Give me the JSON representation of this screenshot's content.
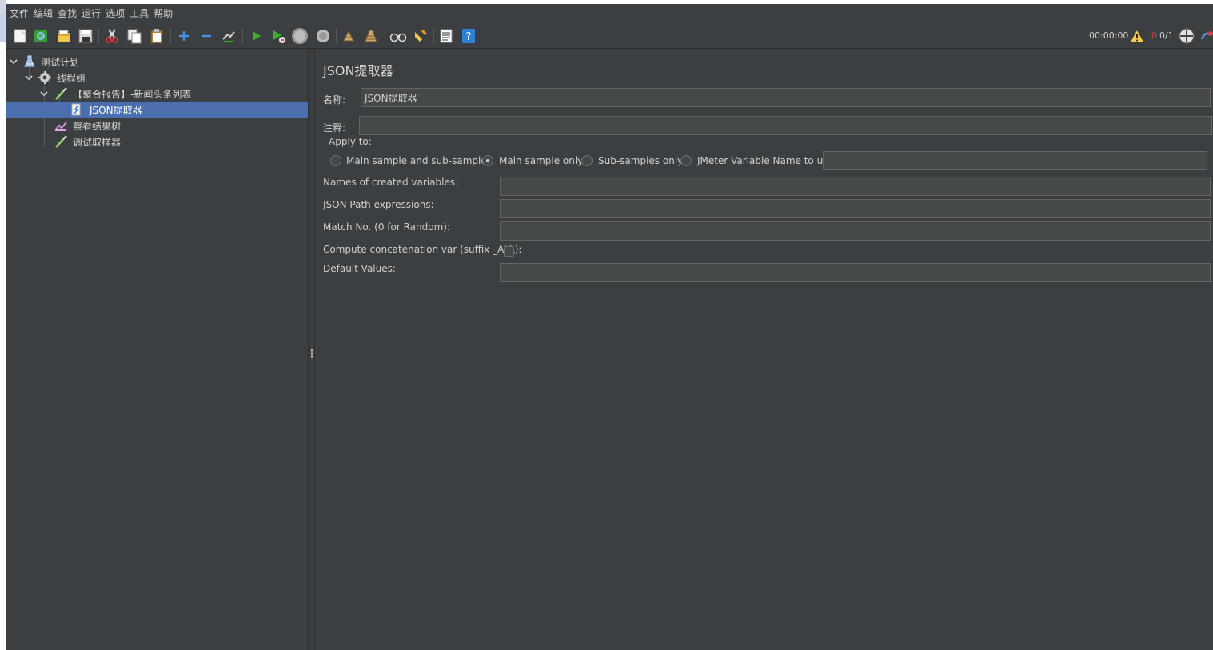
{
  "menu": [
    "文件",
    "编辑",
    "查找",
    "运行",
    "选项",
    "工具",
    "帮助"
  ],
  "toolbar": {
    "timer": "00:00:00",
    "error_count": "0",
    "thread_count": "0/1",
    "icons": [
      "new-icon",
      "templates-icon",
      "open-icon",
      "save-icon",
      "cut-icon",
      "copy-icon",
      "paste-icon",
      "expand-icon",
      "collapse-icon",
      "toggle-icon",
      "start-icon",
      "start-no-pause-icon",
      "stop-icon",
      "shutdown-icon",
      "clear-icon",
      "clear-all-icon",
      "search-icon",
      "reset-search-icon",
      "function-helper-icon",
      "help-icon",
      "warning-icon",
      "remote-icon",
      "lang-icon"
    ]
  },
  "tree": {
    "items": [
      {
        "label": "测试计划",
        "icon": "test-plan-icon"
      },
      {
        "label": "线程组",
        "icon": "thread-group-icon"
      },
      {
        "label": "【聚合报告】-新闻头条列表",
        "icon": "sampler-icon"
      },
      {
        "label": "JSON提取器",
        "icon": "json-extractor-icon"
      },
      {
        "label": "察看结果树",
        "icon": "results-tree-icon"
      },
      {
        "label": "调试取样器",
        "icon": "debug-sampler-icon"
      }
    ]
  },
  "panel": {
    "title": "JSON提取器",
    "name_label": "名称:",
    "name_value": "JSON提取器",
    "comment_label": "注释:",
    "comment_value": "",
    "apply_to_label": "Apply to:",
    "radio_options": [
      "Main sample and sub-samples",
      "Main sample only",
      "Sub-samples only",
      "JMeter Variable Name to use"
    ],
    "selected_radio": "Main sample only",
    "var_name_value": "",
    "created_vars_label": "Names of created variables:",
    "created_vars_value": "",
    "json_path_label": "JSON Path expressions:",
    "json_path_value": "",
    "match_no_label": "Match No. (0 for Random):",
    "match_no_value": "",
    "concat_label": "Compute concatenation var (suffix _ALL):",
    "concat_checked": false,
    "default_values_label": "Default Values:",
    "default_values_value": ""
  },
  "colors": {
    "background": "#3c3f41",
    "selection": "#4b6eaf",
    "input_bg": "#45494a",
    "run_green": "#3dae2b",
    "help_blue": "#2f7fd6"
  }
}
